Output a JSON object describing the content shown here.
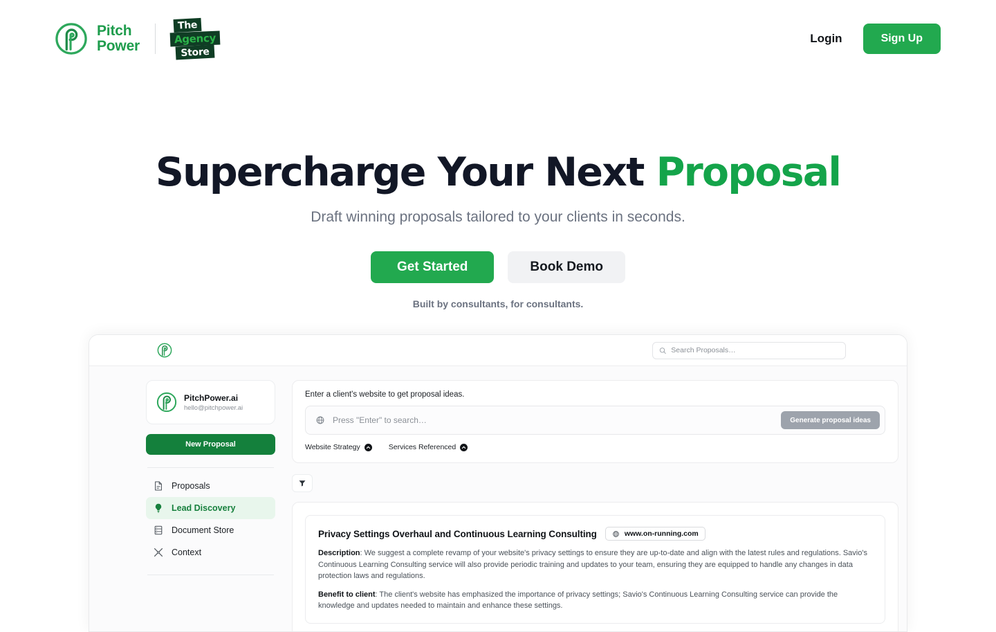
{
  "nav": {
    "brand_line1": "Pitch",
    "brand_line2": "Power",
    "partner": {
      "line1": "The",
      "line2": "Agency",
      "line3": "Store"
    },
    "login_label": "Login",
    "signup_label": "Sign Up"
  },
  "hero": {
    "title_main": "Supercharge Your Next ",
    "title_accent": "Proposal",
    "subtitle": "Draft winning proposals tailored to your clients in seconds.",
    "primary_cta": "Get Started",
    "secondary_cta": "Book Demo",
    "note": "Built by consultants, for consultants."
  },
  "app": {
    "search": {
      "placeholder": "Search Proposals…",
      "value": ""
    },
    "account": {
      "name": "PitchPower.ai",
      "email": "hello@pitchpower.ai"
    },
    "new_proposal_label": "New Proposal",
    "nav_items": [
      {
        "label": "Proposals",
        "icon": "document-icon",
        "active": false
      },
      {
        "label": "Lead Discovery",
        "icon": "lightbulb-icon",
        "active": true
      },
      {
        "label": "Document Store",
        "icon": "database-icon",
        "active": false
      },
      {
        "label": "Context",
        "icon": "tools-icon",
        "active": false
      }
    ],
    "discovery": {
      "label": "Enter a client's website to get proposal ideas.",
      "input_placeholder": "Press \"Enter\" to search…",
      "input_value": "",
      "generate_label": "Generate proposal ideas",
      "toggles": [
        {
          "label": "Website Strategy"
        },
        {
          "label": "Services Referenced"
        }
      ]
    },
    "result": {
      "title": "Privacy Settings Overhaul and Continuous Learning Consulting",
      "url": "www.on-running.com",
      "description_label": "Description",
      "description_text": ": We suggest a complete revamp of your website's privacy settings to ensure they are up-to-date and align with the latest rules and regulations. Savio's Continuous Learning Consulting service will also provide periodic training and updates to your team, ensuring they are equipped to handle any changes in data protection laws and regulations.",
      "benefit_label": "Benefit to client",
      "benefit_text": ": The client's website has emphasized the importance of privacy settings; Savio's Continuous Learning Consulting service can provide the knowledge and updates needed to maintain and enhance these settings."
    }
  },
  "colors": {
    "brand_green": "#1f9d4d",
    "cta_green": "#22a94f",
    "accent_green": "#14a44a",
    "dark_green": "#0f3d24",
    "ink": "#121726"
  }
}
